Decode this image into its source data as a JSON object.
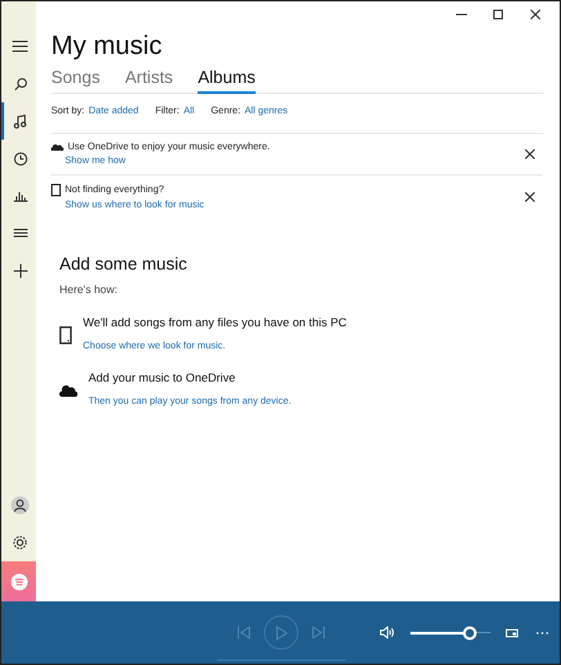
{
  "title": "My music",
  "nav": [
    {
      "kind": "menu",
      "selected": false
    },
    {
      "kind": "search",
      "selected": false
    },
    {
      "kind": "music",
      "selected": true
    },
    {
      "kind": "recent",
      "selected": false
    },
    {
      "kind": "chart",
      "selected": false
    },
    {
      "kind": "playlist",
      "selected": false
    },
    {
      "kind": "plus",
      "selected": false
    }
  ],
  "tabs": [
    {
      "label": "Songs",
      "selected": false
    },
    {
      "label": "Artists",
      "selected": false
    },
    {
      "label": "Albums",
      "selected": true
    }
  ],
  "filters": [
    {
      "label": "Sort by:",
      "value": "Date added"
    },
    {
      "label": "Filter:",
      "value": "All"
    },
    {
      "label": "Genre:",
      "value": "All genres"
    }
  ],
  "banners": [
    {
      "kind": "cloud",
      "text": "Use OneDrive to enjoy your music everywhere.",
      "link": "Show me how"
    },
    {
      "kind": "device",
      "text": "Not finding everything?",
      "link": "Show us where to look for music"
    }
  ],
  "add_music": {
    "heading": "Add some music",
    "subheading": "Here's how:",
    "options": [
      {
        "kind": "device",
        "text": "We'll add songs from any files you have on this PC",
        "link": "Choose where we look for music."
      },
      {
        "kind": "cloud",
        "text": "Add your music to OneDrive",
        "link": "Then you can play your songs from any device."
      }
    ]
  },
  "player": {
    "volume": {
      "level": 0.73
    }
  }
}
